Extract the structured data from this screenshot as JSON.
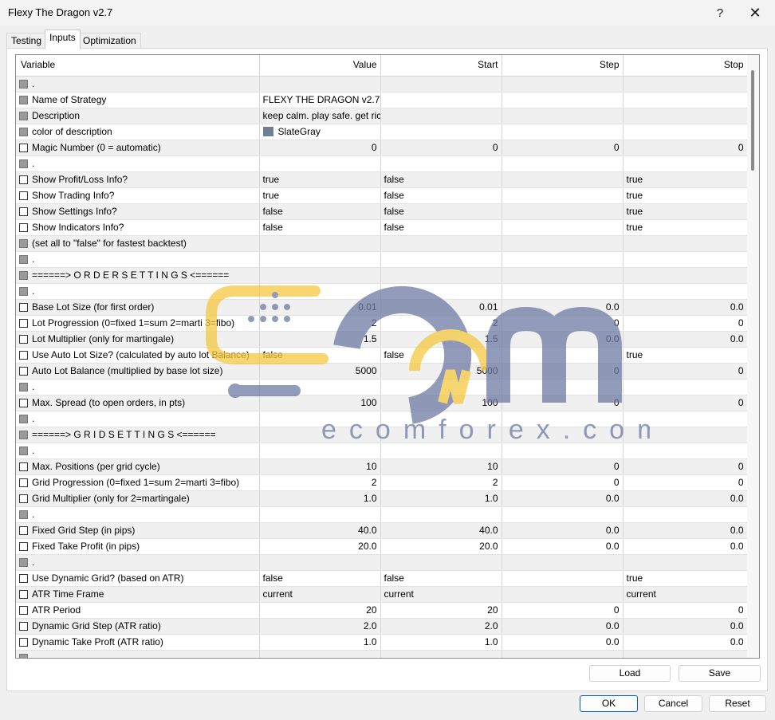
{
  "window": {
    "title": "Flexy The Dragon v2.7",
    "help_glyph": "?",
    "close_glyph": "✕"
  },
  "tabs": [
    {
      "label": "Testing",
      "active": false
    },
    {
      "label": "Inputs",
      "active": true
    },
    {
      "label": "Optimization",
      "active": false
    }
  ],
  "columns": {
    "variable": "Variable",
    "value": "Value",
    "start": "Start",
    "step": "Step",
    "stop": "Stop"
  },
  "rows": [
    {
      "label": ".",
      "checkbox": "grey"
    },
    {
      "label": "Name of Strategy",
      "checkbox": "grey",
      "value": "FLEXY THE DRAGON v2.7"
    },
    {
      "label": "Description",
      "checkbox": "grey",
      "value": "keep calm. play safe. get rich. :)"
    },
    {
      "label": "color of description",
      "checkbox": "grey",
      "value": "SlateGray",
      "swatch": "#708090"
    },
    {
      "label": "Magic Number (0 = automatic)",
      "checkbox": "white",
      "value": "0",
      "start": "0",
      "step": "0",
      "stop": "0",
      "numeric": true
    },
    {
      "label": ".",
      "checkbox": "grey"
    },
    {
      "label": "Show Profit/Loss Info?",
      "checkbox": "white",
      "value": "true",
      "start": "false",
      "step": "",
      "stop": "true"
    },
    {
      "label": "Show Trading Info?",
      "checkbox": "white",
      "value": "true",
      "start": "false",
      "step": "",
      "stop": "true"
    },
    {
      "label": "Show Settings Info?",
      "checkbox": "white",
      "value": "false",
      "start": "false",
      "step": "",
      "stop": "true"
    },
    {
      "label": "Show Indicators Info?",
      "checkbox": "white",
      "value": "false",
      "start": "false",
      "step": "",
      "stop": "true"
    },
    {
      "label": "(set all to \"false\" for fastest backtest)",
      "checkbox": "grey"
    },
    {
      "label": ".",
      "checkbox": "grey"
    },
    {
      "label": "======> O R D E R   S E T T I N G S <======",
      "checkbox": "grey"
    },
    {
      "label": ".",
      "checkbox": "grey"
    },
    {
      "label": "Base Lot Size (for first order)",
      "checkbox": "white",
      "value": "0.01",
      "start": "0.01",
      "step": "0.0",
      "stop": "0.0",
      "numeric": true
    },
    {
      "label": "Lot Progression (0=fixed 1=sum 2=marti 3=fibo)",
      "checkbox": "white",
      "value": "2",
      "start": "2",
      "step": "0",
      "stop": "0",
      "numeric": true
    },
    {
      "label": "Lot Multiplier (only for martingale)",
      "checkbox": "white",
      "value": "1.5",
      "start": "1.5",
      "step": "0.0",
      "stop": "0.0",
      "numeric": true
    },
    {
      "label": "Use Auto Lot Size? (calculated by auto lot Balance)",
      "checkbox": "white",
      "value": "false",
      "start": "false",
      "step": "",
      "stop": "true"
    },
    {
      "label": "Auto Lot Balance (multiplied by base lot size)",
      "checkbox": "white",
      "value": "5000",
      "start": "5000",
      "step": "0",
      "stop": "0",
      "numeric": true
    },
    {
      "label": ".",
      "checkbox": "grey"
    },
    {
      "label": "Max. Spread (to open orders, in pts)",
      "checkbox": "white",
      "value": "100",
      "start": "100",
      "step": "0",
      "stop": "0",
      "numeric": true
    },
    {
      "label": ".",
      "checkbox": "grey"
    },
    {
      "label": "======> G R I D   S E T T I N G S <======",
      "checkbox": "grey"
    },
    {
      "label": ".",
      "checkbox": "grey"
    },
    {
      "label": "Max. Positions (per grid cycle)",
      "checkbox": "white",
      "value": "10",
      "start": "10",
      "step": "0",
      "stop": "0",
      "numeric": true
    },
    {
      "label": "Grid Progression (0=fixed 1=sum 2=marti 3=fibo)",
      "checkbox": "white",
      "value": "2",
      "start": "2",
      "step": "0",
      "stop": "0",
      "numeric": true
    },
    {
      "label": "Grid Multiplier (only for 2=martingale)",
      "checkbox": "white",
      "value": "1.0",
      "start": "1.0",
      "step": "0.0",
      "stop": "0.0",
      "numeric": true
    },
    {
      "label": ".",
      "checkbox": "grey"
    },
    {
      "label": "Fixed Grid Step (in pips)",
      "checkbox": "white",
      "value": "40.0",
      "start": "40.0",
      "step": "0.0",
      "stop": "0.0",
      "numeric": true
    },
    {
      "label": "Fixed Take Profit (in pips)",
      "checkbox": "white",
      "value": "20.0",
      "start": "20.0",
      "step": "0.0",
      "stop": "0.0",
      "numeric": true
    },
    {
      "label": ".",
      "checkbox": "grey"
    },
    {
      "label": "Use Dynamic Grid? (based on ATR)",
      "checkbox": "white",
      "value": "false",
      "start": "false",
      "step": "",
      "stop": "true"
    },
    {
      "label": "ATR Time Frame",
      "checkbox": "white",
      "value": "current",
      "start": "current",
      "step": "",
      "stop": "current"
    },
    {
      "label": "ATR Period",
      "checkbox": "white",
      "value": "20",
      "start": "20",
      "step": "0",
      "stop": "0",
      "numeric": true
    },
    {
      "label": "Dynamic Grid Step (ATR ratio)",
      "checkbox": "white",
      "value": "2.0",
      "start": "2.0",
      "step": "0.0",
      "stop": "0.0",
      "numeric": true
    },
    {
      "label": "Dynamic Take Proft (ATR ratio)",
      "checkbox": "white",
      "value": "1.0",
      "start": "1.0",
      "step": "0.0",
      "stop": "0.0",
      "numeric": true
    },
    {
      "label": "",
      "checkbox": "grey"
    }
  ],
  "buttons": {
    "load": "Load",
    "save": "Save",
    "ok": "OK",
    "cancel": "Cancel",
    "reset": "Reset"
  },
  "watermark": {
    "text": "ecomforex.com",
    "color_blue": "#6f7aa3",
    "color_yellow": "#f5c842"
  }
}
